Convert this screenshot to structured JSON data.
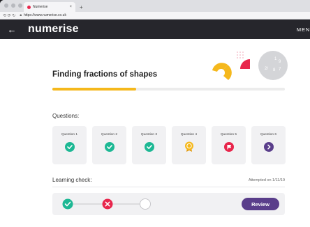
{
  "browser": {
    "tab_title": "Numerise",
    "tab_close": "×",
    "new_tab": "+",
    "url": "https://www.numerise.co.uk",
    "nav_buttons": "⟲ ⟳ ↻"
  },
  "appbar": {
    "back_icon": "←",
    "logo": "numerise",
    "menu_label": "MEN"
  },
  "page": {
    "title": "Finding fractions of shapes",
    "progress_fraction": 0.36,
    "decoration_numbers": [
      "1",
      "9",
      "2/",
      "8",
      "7"
    ]
  },
  "questions": {
    "label": "Questions:",
    "items": [
      {
        "label": "Question 1",
        "status": "correct",
        "icon": "check-icon",
        "color": "#1db894"
      },
      {
        "label": "Question 2",
        "status": "correct",
        "icon": "check-icon",
        "color": "#1db894"
      },
      {
        "label": "Question 3",
        "status": "correct",
        "icon": "check-icon",
        "color": "#1db894"
      },
      {
        "label": "Question 4",
        "status": "award",
        "icon": "rosette-icon",
        "color": "#f5b81c"
      },
      {
        "label": "Question 5",
        "status": "flagged",
        "icon": "flag-icon",
        "color": "#e8264c"
      },
      {
        "label": "Question 6",
        "status": "next",
        "icon": "chevron-right-icon",
        "color": "#5a3e8b"
      }
    ]
  },
  "learning_check": {
    "label": "Learning check:",
    "attempted": "Attempted on 1/11/19",
    "steps": [
      {
        "status": "correct",
        "icon": "check-icon",
        "color": "#1db894"
      },
      {
        "status": "incorrect",
        "icon": "cross-icon",
        "color": "#e8264c"
      },
      {
        "status": "pending",
        "icon": "empty-circle-icon",
        "color": "#ffffff"
      }
    ],
    "review_label": "Review"
  },
  "colors": {
    "header_bg": "#26262c",
    "accent_yellow": "#f5b81c",
    "accent_pink": "#e8264c",
    "accent_purple": "#5a3e8b",
    "success_green": "#1db894"
  }
}
